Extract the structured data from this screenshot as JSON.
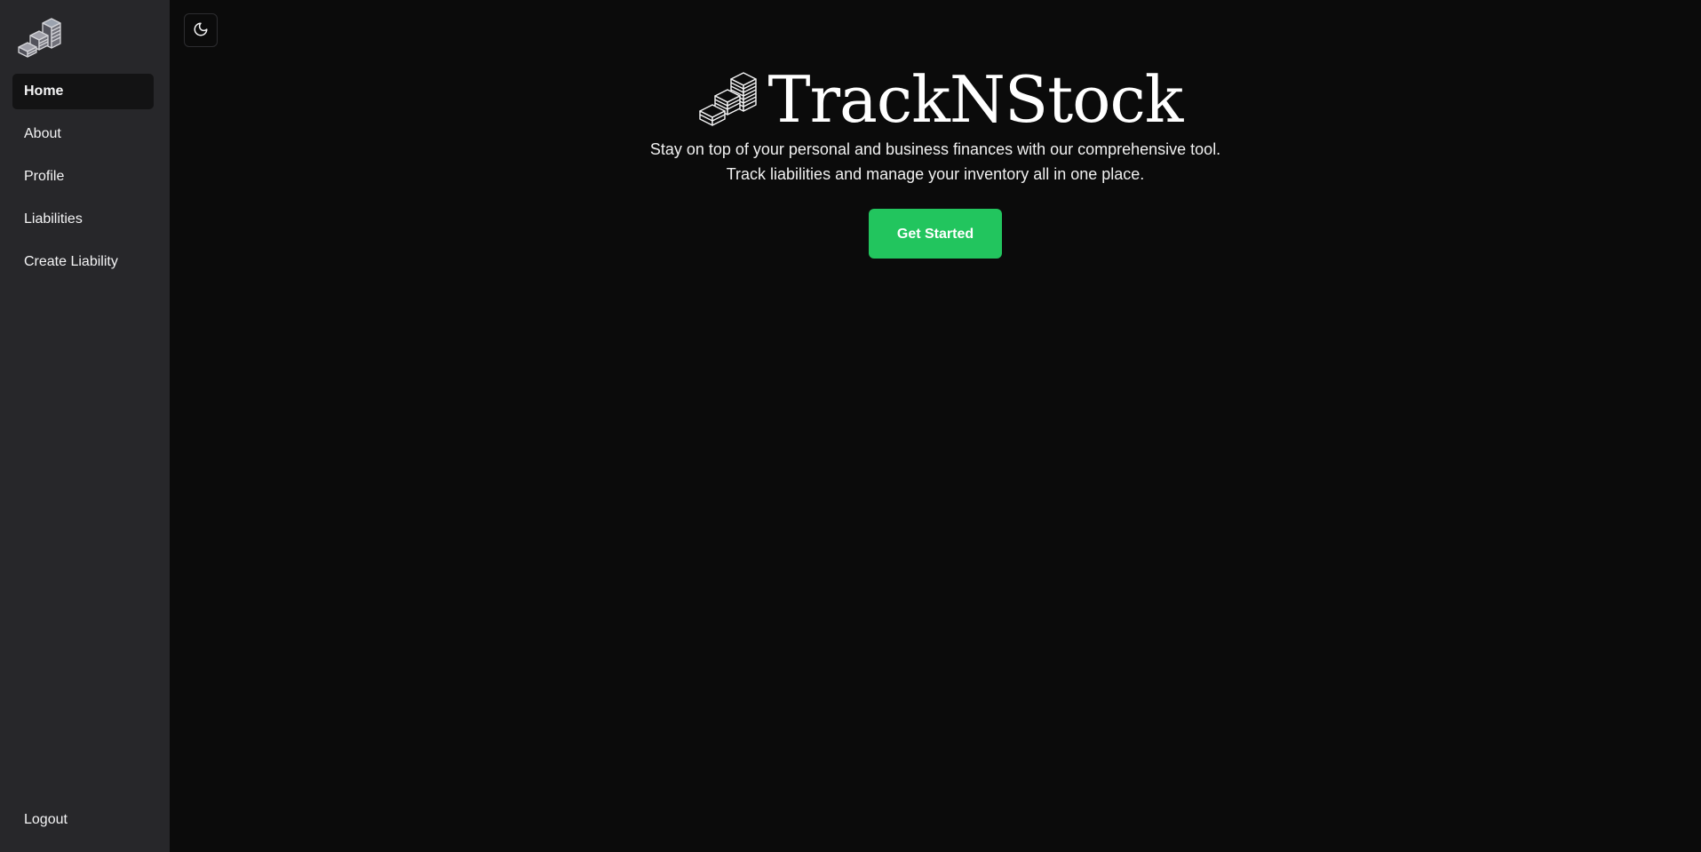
{
  "app": {
    "brand_name": "TrackNStock"
  },
  "sidebar": {
    "logo_icon": "stacked-boxes-logo",
    "items": [
      {
        "label": "Home",
        "active": true
      },
      {
        "label": "About",
        "active": false
      },
      {
        "label": "Profile",
        "active": false
      },
      {
        "label": "Liabilities",
        "active": false
      },
      {
        "label": "Create Liability",
        "active": false
      }
    ],
    "logout_label": "Logout"
  },
  "topbar": {
    "theme_toggle_icon": "moon-icon"
  },
  "hero": {
    "title": "TrackNStock",
    "subtitle_line1": "Stay on top of your personal and business finances with our comprehensive tool.",
    "subtitle_line2": "Track liabilities and manage your inventory all in one place.",
    "cta_label": "Get Started"
  },
  "colors": {
    "sidebar_bg": "#27272a",
    "main_bg": "#0b0b0b",
    "accent": "#22c55e",
    "active_item_bg": "#131314"
  }
}
